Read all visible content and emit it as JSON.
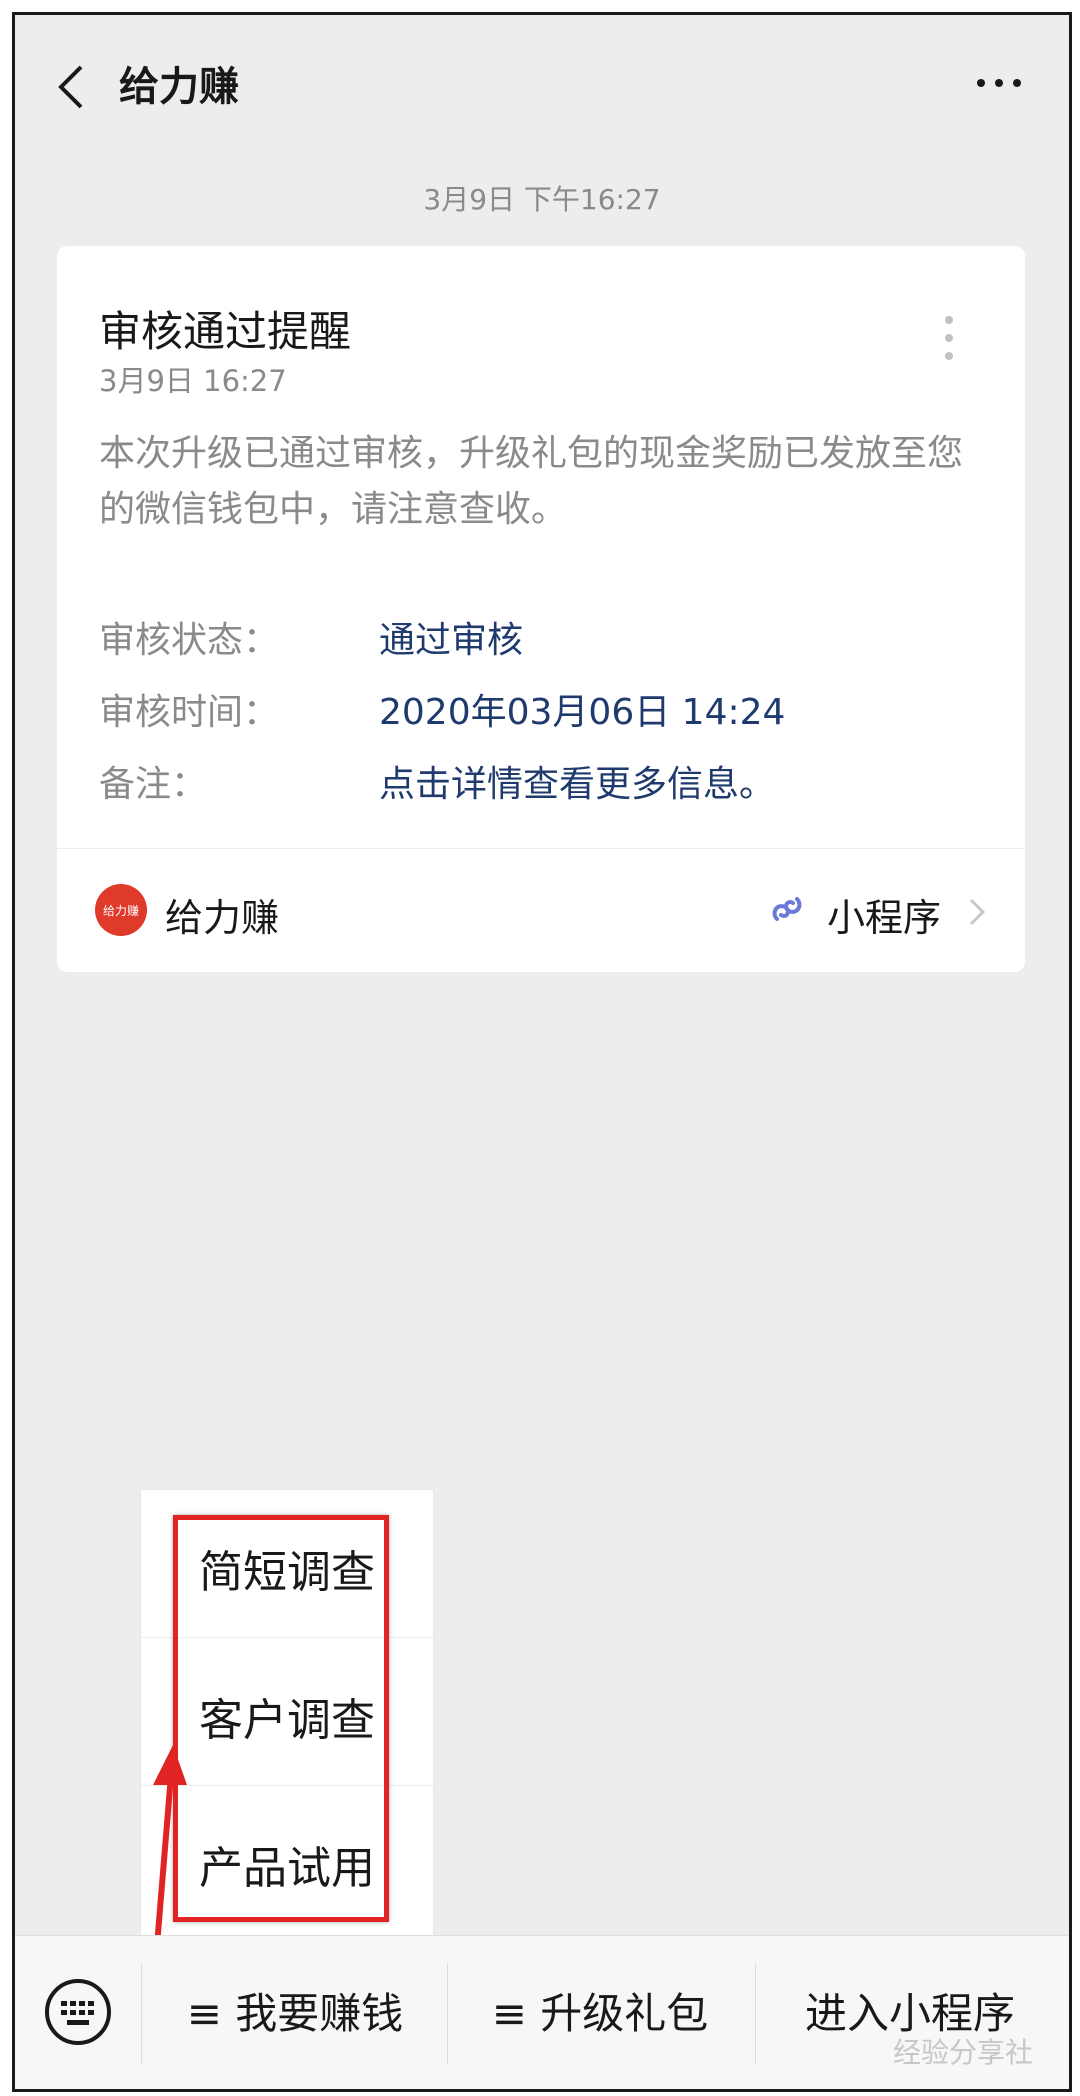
{
  "header": {
    "title": "给力赚",
    "back_icon": "back-arrow-icon",
    "more_icon": "more-dots-icon"
  },
  "chat_time": "3月9日 下午16:27",
  "card": {
    "title": "审核通过提醒",
    "date": "3月9日  16:27",
    "description": "本次升级已通过审核，升级礼包的现金奖励已发放至您的微信钱包中，请注意查收。",
    "fields": [
      {
        "label": "审核状态：",
        "value": "通过审核"
      },
      {
        "label": "审核时间：",
        "value": "2020年03月06日 14:24"
      },
      {
        "label": "备注：",
        "value": "点击详情查看更多信息。"
      }
    ],
    "footer": {
      "app_logo_text": "给力赚",
      "app_name": "给力赚",
      "mini_program_label": "小程序",
      "mini_program_icon": "mini-program-link-icon"
    }
  },
  "popup_menu": {
    "items": [
      "简短调查",
      "客户调查",
      "产品试用"
    ]
  },
  "bottom_bar": {
    "keyboard_icon": "keyboard-icon",
    "items": [
      "≡ 我要赚钱",
      "≡ 升级礼包",
      "进入小程序"
    ]
  },
  "watermark": "经验分享社",
  "colors": {
    "link": "#1f3a6d",
    "highlight": "#e02424",
    "logo": "#e03a2b",
    "background": "#ededed"
  }
}
